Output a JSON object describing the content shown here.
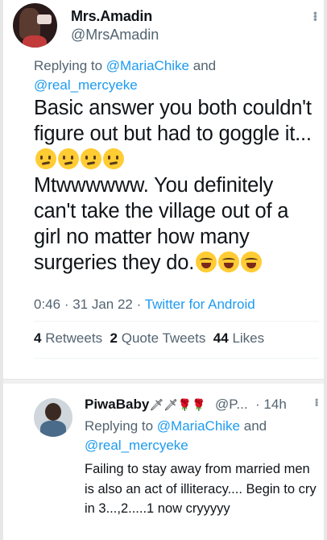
{
  "main_tweet": {
    "display_name": "Mrs.Amadin",
    "handle": "@MrsAmadin",
    "replying_prefix": "Replying to ",
    "replying_user_1": "@MariaChike",
    "replying_and": " and",
    "replying_user_2": "@real_mercyeke",
    "text_part_1": "Basic answer you both couldn't figure out but had to goggle it...",
    "text_part_2": "Mtwwwwww. You definitely can't take the village out of a girl no matter how many surgeries they do.",
    "confused_emoji_icon": "confused-face-icon",
    "laugh_emoji_icon": "tears-of-joy-icon",
    "time": "0:46",
    "date": "31 Jan 22",
    "source": "Twitter for Android",
    "retweets_count": "4",
    "retweets_label": "Retweets",
    "quotes_count": "2",
    "quotes_label": "Quote Tweets",
    "likes_count": "44",
    "likes_label": "Likes"
  },
  "reply_tweet": {
    "display_name": "PiwaBaby",
    "name_emojis": "🗡🗡🌹🌹",
    "handle": "@P...",
    "time": "· 14h",
    "replying_prefix": "Replying to ",
    "replying_user_1": "@MariaChike",
    "replying_and": " and",
    "replying_user_2": "@real_mercyeke",
    "text": "Failing to stay away from married men is also an act of illiteracy.... Begin to cry in 3...,2.....1 now cryyyyy"
  },
  "colors": {
    "link": "#1d9bf0",
    "secondary_text": "#536471",
    "primary_text": "#0f1419"
  }
}
